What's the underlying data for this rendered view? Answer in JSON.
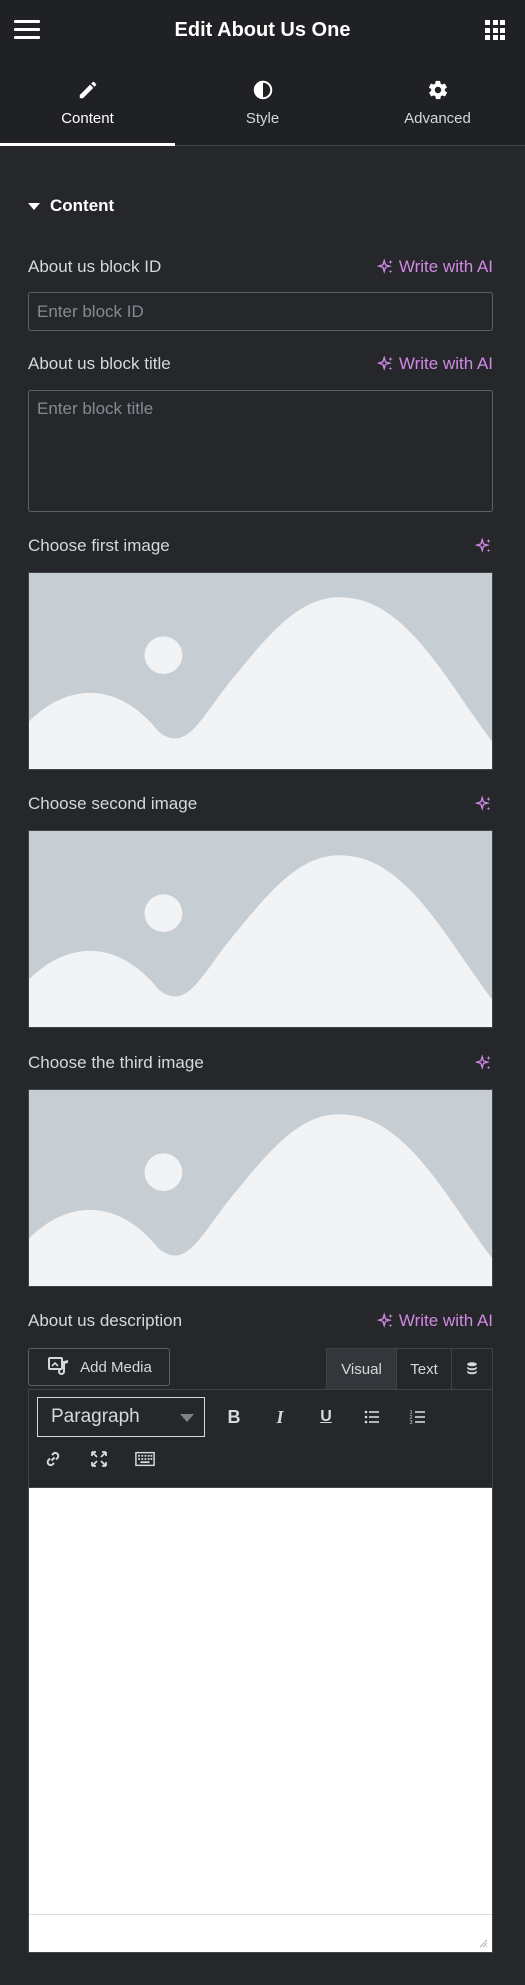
{
  "header": {
    "title": "Edit About Us One"
  },
  "tabs": [
    {
      "label": "Content",
      "icon": "pencil-icon",
      "active": true
    },
    {
      "label": "Style",
      "icon": "contrast-icon",
      "active": false
    },
    {
      "label": "Advanced",
      "icon": "gear-icon",
      "active": false
    }
  ],
  "section": {
    "title": "Content"
  },
  "fields": {
    "block_id": {
      "label": "About us block ID",
      "placeholder": "Enter block ID",
      "value": "",
      "ai_label": "Write with AI"
    },
    "block_title": {
      "label": "About us block title",
      "placeholder": "Enter block title",
      "value": "",
      "ai_label": "Write with AI"
    },
    "first_image": {
      "label": "Choose first image"
    },
    "second_image": {
      "label": "Choose second image"
    },
    "third_image": {
      "label": "Choose the third image"
    },
    "description": {
      "label": "About us description",
      "ai_label": "Write with AI"
    }
  },
  "editor": {
    "add_media_label": "Add Media",
    "mode_visual": "Visual",
    "mode_text": "Text",
    "format_value": "Paragraph",
    "bold": "B",
    "italic": "I",
    "underline": "U"
  },
  "colors": {
    "accent_ai": "#d08ae5",
    "panel_bg": "#26272b",
    "header_bg": "#1f2124",
    "image_placeholder": "#c6cdd3"
  }
}
